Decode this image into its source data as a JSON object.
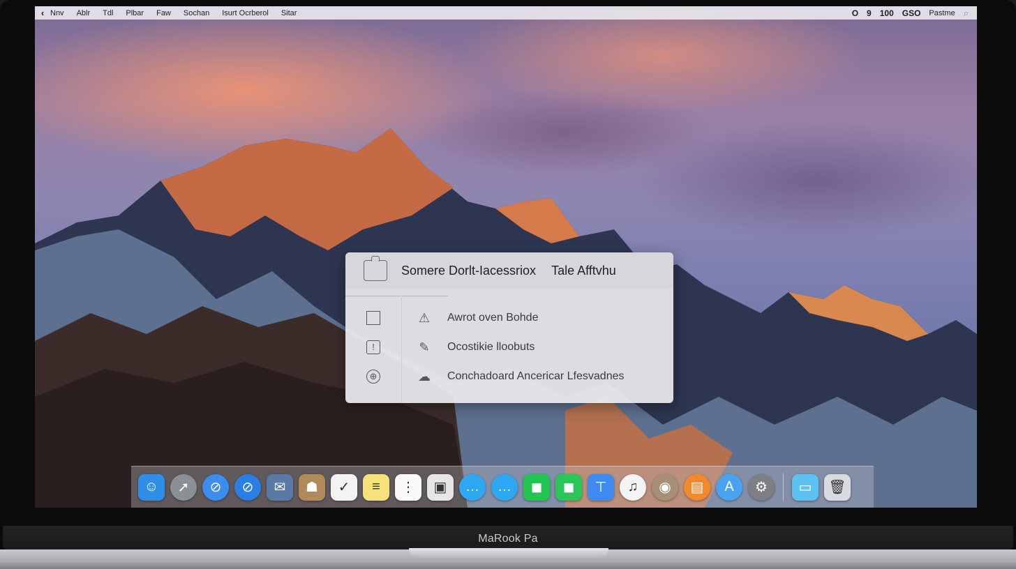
{
  "device": {
    "label": "MaRook Pa"
  },
  "menubar": {
    "apple_glyph": "‹",
    "items": [
      "Nnv",
      "Ablr",
      "Tdl",
      "Plbar",
      "Faw",
      "Sochan",
      "Isurt Ocrberol",
      "Sitar"
    ],
    "status": [
      "O",
      "9",
      "100",
      "GSO"
    ],
    "username": "Pastme",
    "search_glyph": "⌕"
  },
  "dialog": {
    "title": "Somere Dorlt-Iacessriox",
    "title_right": "Tale Afftvhu",
    "rows": [
      {
        "lead_glyph": "",
        "icon": "⚠",
        "icon_name": "warning-icon",
        "label": "Awrot oven Bohde"
      },
      {
        "lead_glyph": "!",
        "icon": "✎",
        "icon_name": "leaf-icon",
        "label": "Ocostikie lloobuts"
      },
      {
        "lead_glyph": "⊕",
        "icon": "☁",
        "icon_name": "cloud-icon",
        "label": "Conchadoard Ancericar Lfesvadnes"
      }
    ]
  },
  "dock": {
    "apps": [
      {
        "name": "finder",
        "glyph": "☺",
        "bg": "#2f8ee8"
      },
      {
        "name": "launchpad",
        "glyph": "➚",
        "bg": "#8b8f96"
      },
      {
        "name": "safari",
        "glyph": "⊘",
        "bg": "#3b8df0"
      },
      {
        "name": "safari-alt",
        "glyph": "⊘",
        "bg": "#2a7fe6"
      },
      {
        "name": "mail-stamp",
        "glyph": "✉",
        "bg": "#5a7aa6"
      },
      {
        "name": "contacts",
        "glyph": "☗",
        "bg": "#b08a58"
      },
      {
        "name": "calendar",
        "glyph": "✓",
        "bg": "#f3f3f3"
      },
      {
        "name": "notes",
        "glyph": "≡",
        "bg": "#f6e27a"
      },
      {
        "name": "reminders",
        "glyph": "⋮",
        "bg": "#fafafa"
      },
      {
        "name": "photos-preview",
        "glyph": "▣",
        "bg": "#e6e6e6"
      },
      {
        "name": "messages",
        "glyph": "…",
        "bg": "#2ea7f2"
      },
      {
        "name": "messages-alt",
        "glyph": "…",
        "bg": "#2ea7f2"
      },
      {
        "name": "facetime",
        "glyph": "◼",
        "bg": "#23c552"
      },
      {
        "name": "facetime-alt",
        "glyph": "◼",
        "bg": "#2cc55a"
      },
      {
        "name": "keynote",
        "glyph": "⊤",
        "bg": "#3d8bf2"
      },
      {
        "name": "itunes",
        "glyph": "♫",
        "bg": "#f4f4f6"
      },
      {
        "name": "ibooks-disc",
        "glyph": "◉",
        "bg": "#a88f7a"
      },
      {
        "name": "ibooks",
        "glyph": "▤",
        "bg": "#f28a2b"
      },
      {
        "name": "app-store",
        "glyph": "A",
        "bg": "#4aa3f0"
      },
      {
        "name": "system-preferences",
        "glyph": "⚙",
        "bg": "#7d7f85"
      }
    ],
    "trailing": [
      {
        "name": "downloads-folder",
        "glyph": "▭",
        "bg": "#5cc2f2"
      },
      {
        "name": "trash",
        "glyph": "🗑",
        "bg": "#d9dbe0"
      }
    ]
  }
}
